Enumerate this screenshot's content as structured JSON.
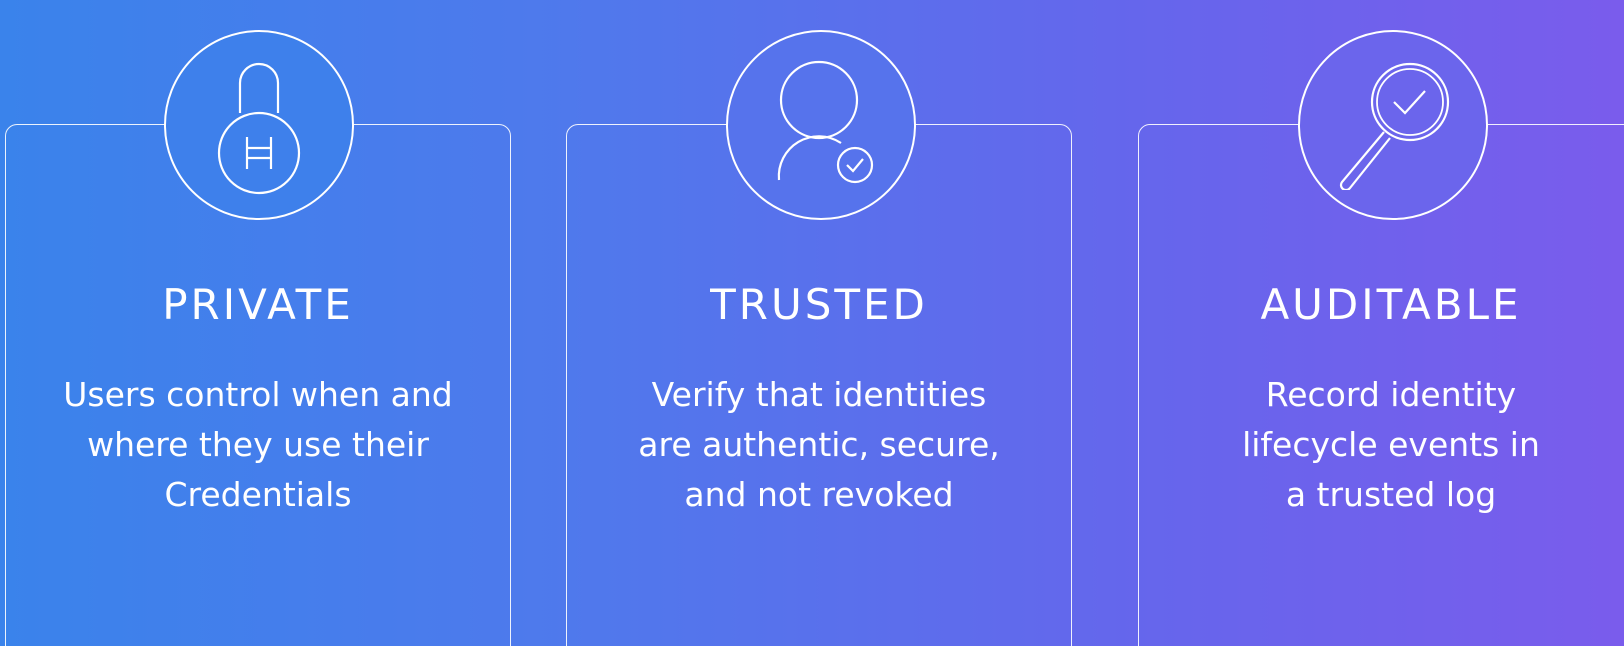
{
  "features": [
    {
      "title": "PRIVATE",
      "description_lines": [
        "Users control when and",
        "where they use their",
        "Credentials"
      ],
      "icon": "padlock-hbar-icon"
    },
    {
      "title": "TRUSTED",
      "description_lines": [
        "Verify that identities",
        "are authentic, secure,",
        "and not revoked"
      ],
      "icon": "user-check-icon"
    },
    {
      "title": "AUDITABLE",
      "description_lines": [
        "Record identity",
        "lifecycle events in",
        "a trusted log"
      ],
      "icon": "magnifier-check-icon"
    }
  ],
  "colors": {
    "gradient_start": "#3a83eb",
    "gradient_end": "#7a5cec",
    "foreground": "#ffffff"
  }
}
